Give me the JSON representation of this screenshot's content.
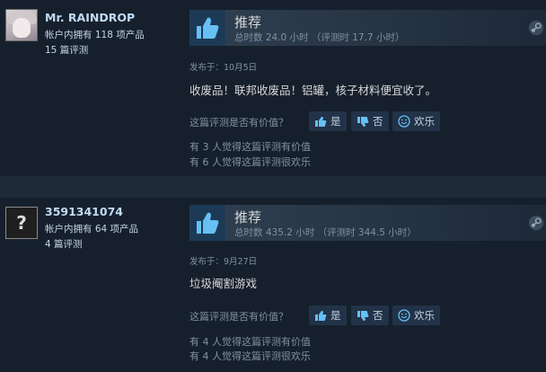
{
  "reviews": [
    {
      "username": "Mr. RAINDROP",
      "products": "帐户内拥有 118 项产品",
      "review_count": "15 篇评测",
      "verdict": "推荐",
      "hours": "总时数 24.0 小时 （评测时 17.7 小时）",
      "posted": "发布于：10月5日",
      "content": "收废品！联邦收废品！铝罐，核子材料便宜收了。",
      "helpful_question": "这篇评测是否有价值？",
      "buttons": {
        "yes": "是",
        "no": "否",
        "funny": "欢乐"
      },
      "helpful_stat": "有 3 人觉得这篇评测有价值",
      "funny_stat": "有 6 人觉得这篇评测很欢乐"
    },
    {
      "username": "3591341074",
      "products": "帐户内拥有 64 项产品",
      "review_count": "4 篇评测",
      "verdict": "推荐",
      "hours": "总时数 435.2 小时 （评测时 344.5 小时）",
      "posted": "发布于：9月27日",
      "content": "垃圾阉割游戏",
      "helpful_question": "这篇评测是否有价值？",
      "buttons": {
        "yes": "是",
        "no": "否",
        "funny": "欢乐"
      },
      "helpful_stat": "有 4 人觉得这篇评测有价值",
      "funny_stat": "有 4 人觉得这篇评测很欢乐"
    }
  ],
  "avatar_unknown_glyph": "?",
  "colors": {
    "page_bg": "#1b2838",
    "panel_bg": "#16202d",
    "accent_blue": "#66c0f4",
    "thumb_bg": "#1c3a56"
  },
  "icons": [
    "thumbs-up-icon",
    "steam-logo-icon",
    "vote-up-icon",
    "vote-down-icon",
    "smiley-icon"
  ]
}
